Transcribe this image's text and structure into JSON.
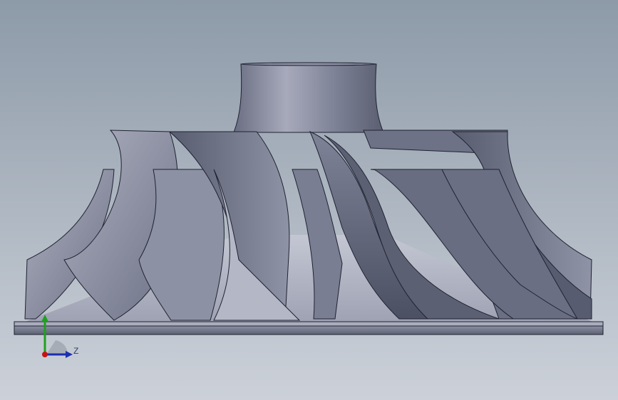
{
  "viewport": {
    "background_top": "#8d9aa8",
    "background_bottom": "#c9cfd8"
  },
  "model": {
    "part": "impeller",
    "blade_count_visible": 14,
    "color_light": "#9ea2b3",
    "color_mid": "#6f7388",
    "color_dark": "#474b5c",
    "edge_color": "#1f2230"
  },
  "triad": {
    "y_label": "Y",
    "z_label": "Z",
    "y_color": "#1fa01f",
    "z_color": "#1c2fb0",
    "x_color": "#c41414"
  }
}
